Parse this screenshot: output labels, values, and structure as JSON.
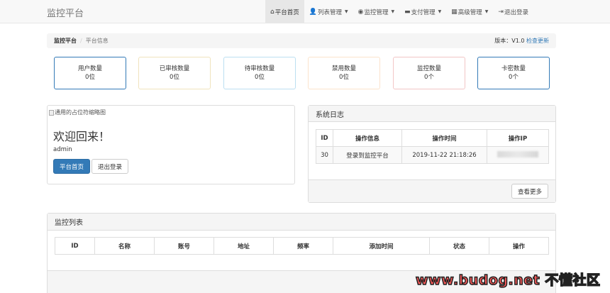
{
  "navbar": {
    "brand": "监控平台",
    "items": [
      {
        "icon": "⌂",
        "label": "平台首页",
        "active": true,
        "caret": false
      },
      {
        "icon": "👤",
        "label": "列表管理",
        "active": false,
        "caret": true
      },
      {
        "icon": "◉",
        "label": "监控管理",
        "active": false,
        "caret": true
      },
      {
        "icon": "▬",
        "label": "支付管理",
        "active": false,
        "caret": true
      },
      {
        "icon": "▦",
        "label": "高级管理",
        "active": false,
        "caret": true
      },
      {
        "icon": "⇥",
        "label": "退出登录",
        "active": false,
        "caret": false
      }
    ]
  },
  "breadcrumb": {
    "home": "监控平台",
    "separator": "/",
    "current": "平台信息",
    "version_label": "版本：V1.0 ",
    "update_link": "检查更新"
  },
  "stats": [
    {
      "label": "用户数量",
      "value": "0位",
      "border": "#337ab7"
    },
    {
      "label": "已审核数量",
      "value": "0位",
      "border": "#f0e3bd"
    },
    {
      "label": "待审核数量",
      "value": "0位",
      "border": "#bcdff1"
    },
    {
      "label": "禁用数量",
      "value": "0位",
      "border": "#fbe3cc"
    },
    {
      "label": "监控数量",
      "value": "0个",
      "border": "#f2c6c6"
    },
    {
      "label": "卡密数量",
      "value": "0个",
      "border": "#337ab7"
    }
  ],
  "welcome": {
    "image_alt": "通用的占位符缩略图",
    "title": "欢迎回来！",
    "username": "admin",
    "home_button": "平台首页",
    "logout_button": "退出登录"
  },
  "syslog": {
    "title": "系统日志",
    "columns": [
      "ID",
      "操作信息",
      "操作时间",
      "操作IP"
    ],
    "rows": [
      {
        "id": "30",
        "info": "登录到监控平台",
        "time": "2019-11-22 21:18:26"
      }
    ],
    "more_button": "查看更多"
  },
  "monitor": {
    "title": "监控列表",
    "columns": [
      "ID",
      "名称",
      "账号",
      "地址",
      "频率",
      "添加时间",
      "状态",
      "操作"
    ]
  },
  "watermark": "www.budog.net 不懂社区",
  "colors": {
    "primary": "#337ab7",
    "watermark": "#ff5a5a"
  }
}
